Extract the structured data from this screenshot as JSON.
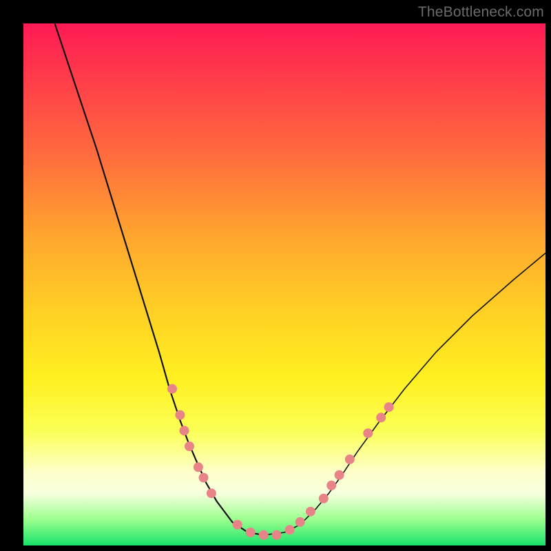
{
  "watermark": "TheBottleneck.com",
  "chart_data": {
    "type": "line",
    "title": "",
    "xlabel": "",
    "ylabel": "",
    "xlim": [
      0,
      100
    ],
    "ylim": [
      0,
      100
    ],
    "series": [
      {
        "name": "left-branch",
        "x": [
          6,
          10,
          14,
          18,
          22,
          26,
          28,
          30,
          31.5,
          33,
          35,
          37,
          40,
          43,
          46
        ],
        "y": [
          100,
          88,
          76,
          63,
          50,
          37,
          30,
          24,
          20,
          16.5,
          12,
          8.5,
          4.5,
          2.5,
          2
        ]
      },
      {
        "name": "right-branch",
        "x": [
          46,
          50,
          53,
          56,
          58.5,
          61,
          64,
          68,
          73,
          79,
          86,
          94,
          100
        ],
        "y": [
          2,
          2.5,
          4,
          7,
          10,
          13.5,
          18,
          23.5,
          30,
          37,
          44,
          51,
          56
        ]
      }
    ],
    "markers": {
      "name": "highlight-points",
      "color": "#e88488",
      "radius_px": 7,
      "points": [
        {
          "x": 28.5,
          "y": 30
        },
        {
          "x": 30.0,
          "y": 25
        },
        {
          "x": 30.8,
          "y": 22
        },
        {
          "x": 31.8,
          "y": 19
        },
        {
          "x": 33.5,
          "y": 15
        },
        {
          "x": 34.5,
          "y": 13
        },
        {
          "x": 36.0,
          "y": 10
        },
        {
          "x": 41.0,
          "y": 4
        },
        {
          "x": 43.5,
          "y": 2.5
        },
        {
          "x": 46.0,
          "y": 2
        },
        {
          "x": 48.5,
          "y": 2
        },
        {
          "x": 51.0,
          "y": 3
        },
        {
          "x": 53.0,
          "y": 4.5
        },
        {
          "x": 55.0,
          "y": 6.5
        },
        {
          "x": 57.5,
          "y": 9
        },
        {
          "x": 59.0,
          "y": 11.5
        },
        {
          "x": 60.5,
          "y": 13.5
        },
        {
          "x": 62.5,
          "y": 16.5
        },
        {
          "x": 66.0,
          "y": 21.5
        },
        {
          "x": 68.5,
          "y": 24.5
        },
        {
          "x": 70.0,
          "y": 26.5
        }
      ]
    }
  }
}
